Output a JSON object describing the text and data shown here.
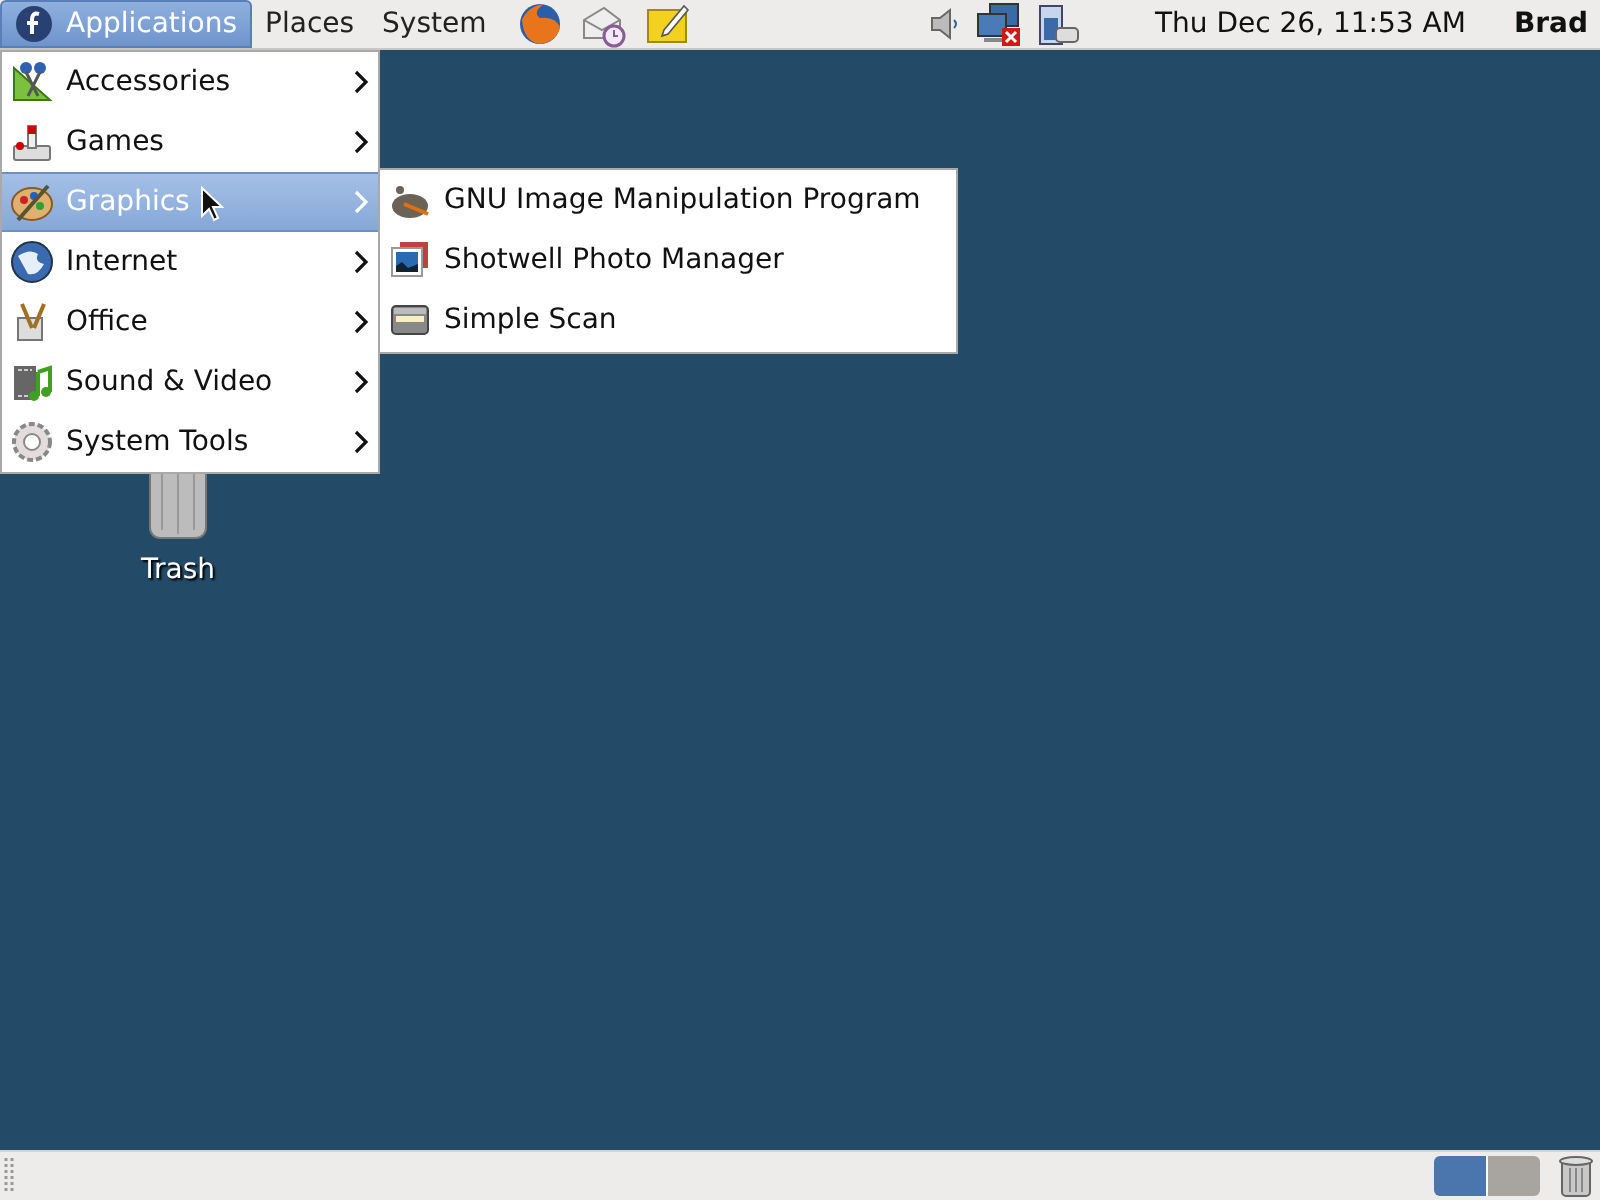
{
  "top_panel": {
    "menus": [
      {
        "label": "Applications",
        "selected": true
      },
      {
        "label": "Places",
        "selected": false
      },
      {
        "label": "System",
        "selected": false
      }
    ],
    "clock": "Thu Dec 26, 11:53 AM",
    "user": "Brad"
  },
  "applications_menu": {
    "items": [
      {
        "label": "Accessories",
        "selected": false
      },
      {
        "label": "Games",
        "selected": false
      },
      {
        "label": "Graphics",
        "selected": true
      },
      {
        "label": "Internet",
        "selected": false
      },
      {
        "label": "Office",
        "selected": false
      },
      {
        "label": "Sound & Video",
        "selected": false
      },
      {
        "label": "System Tools",
        "selected": false
      }
    ],
    "submenu": {
      "items": [
        {
          "label": "GNU Image Manipulation Program",
          "selected": false
        },
        {
          "label": "Shotwell Photo Manager",
          "selected": false
        },
        {
          "label": "Simple Scan",
          "selected": false
        }
      ]
    }
  },
  "desktop": {
    "icons": [
      {
        "label": "Trash"
      }
    ]
  },
  "bottom_panel": {
    "workspaces": [
      {
        "selected": true
      },
      {
        "selected": false
      }
    ]
  }
}
